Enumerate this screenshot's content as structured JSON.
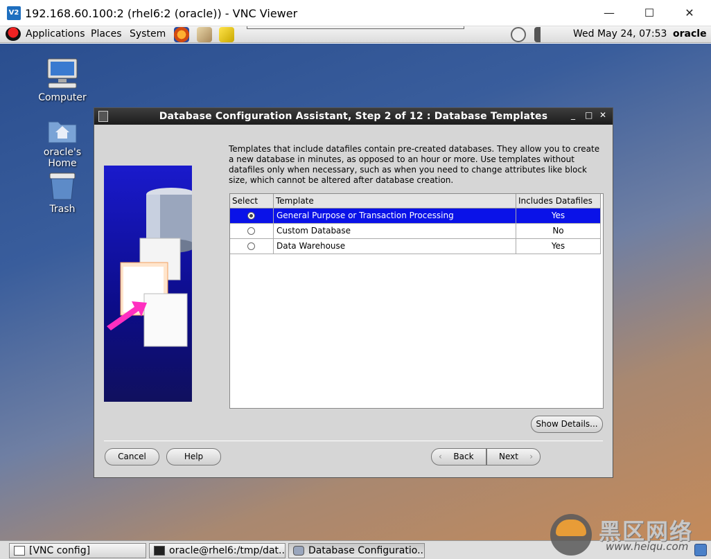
{
  "window": {
    "app_icon_label": "V2",
    "title": "192.168.60.100:2 (rhel6:2 (oracle)) - VNC Viewer",
    "minimize": "—",
    "maximize": "☐",
    "close": "✕"
  },
  "panel": {
    "menus": [
      "Applications",
      "Places",
      "System"
    ],
    "clock": "Wed May 24, 07:53",
    "user": "oracle"
  },
  "desktop": {
    "icons": [
      {
        "label": "Computer",
        "icon": "computer-icon"
      },
      {
        "label": "oracle's Home",
        "icon": "home-folder-icon"
      },
      {
        "label": "Trash",
        "icon": "trash-icon"
      }
    ]
  },
  "dialog": {
    "title": "Database Configuration Assistant, Step 2 of 12 : Database Templates",
    "controls": {
      "minimize": "_",
      "maximize": "□",
      "close": "✕"
    },
    "description": "Templates that include datafiles contain pre-created databases. They allow you to create a new database in minutes, as opposed to an hour or more. Use templates without datafiles only when necessary, such as when you need to change attributes like block size, which cannot be altered after database creation.",
    "table": {
      "headers": [
        "Select",
        "Template",
        "Includes Datafiles"
      ],
      "rows": [
        {
          "template": "General Purpose or Transaction Processing",
          "includes": "Yes",
          "selected": true
        },
        {
          "template": "Custom Database",
          "includes": "No",
          "selected": false
        },
        {
          "template": "Data Warehouse",
          "includes": "Yes",
          "selected": false
        }
      ]
    },
    "buttons": {
      "show_details": "Show Details...",
      "cancel": "Cancel",
      "help": "Help",
      "back": "Back",
      "next": "Next"
    }
  },
  "taskbar": {
    "tasks": [
      {
        "label": "[VNC config]",
        "icon": "window-icon"
      },
      {
        "label": "oracle@rhel6:/tmp/dat...",
        "icon": "terminal-icon"
      },
      {
        "label": "Database Configuratio...",
        "icon": "database-icon"
      }
    ]
  },
  "watermark": {
    "text": "黑区网络",
    "url": "www.heiqu.com"
  }
}
